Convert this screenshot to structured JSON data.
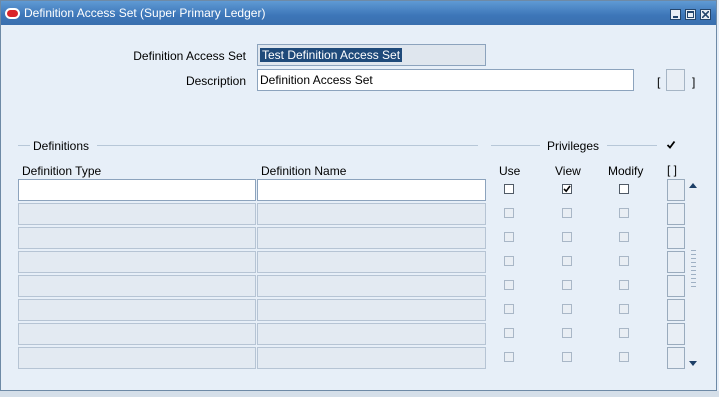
{
  "window": {
    "title": "Definition Access Set (Super Primary Ledger)"
  },
  "form": {
    "access_set_label": "Definition Access Set",
    "access_set_value": "Test Definition Access Set",
    "description_label": "Description",
    "description_value": "Definition Access Set",
    "dff_open": "[",
    "dff_close": "]"
  },
  "definitions": {
    "section_title": "Definitions",
    "privileges_title": "Privileges",
    "col_type": "Definition Type",
    "col_name": "Definition Name",
    "col_use": "Use",
    "col_view": "View",
    "col_modify": "Modify",
    "col_dff": "[ ]",
    "header_checkbox_checked": true,
    "rows": [
      {
        "type": "",
        "name": "",
        "use": false,
        "view": true,
        "modify": false,
        "enabled": true
      },
      {
        "type": "",
        "name": "",
        "use": false,
        "view": false,
        "modify": false,
        "enabled": false
      },
      {
        "type": "",
        "name": "",
        "use": false,
        "view": false,
        "modify": false,
        "enabled": false
      },
      {
        "type": "",
        "name": "",
        "use": false,
        "view": false,
        "modify": false,
        "enabled": false
      },
      {
        "type": "",
        "name": "",
        "use": false,
        "view": false,
        "modify": false,
        "enabled": false
      },
      {
        "type": "",
        "name": "",
        "use": false,
        "view": false,
        "modify": false,
        "enabled": false
      },
      {
        "type": "",
        "name": "",
        "use": false,
        "view": false,
        "modify": false,
        "enabled": false
      },
      {
        "type": "",
        "name": "",
        "use": false,
        "view": false,
        "modify": false,
        "enabled": false
      }
    ]
  },
  "icons": {
    "app": "oracle-icon",
    "minimize": "minimize-icon",
    "maximize": "maximize-icon",
    "close": "close-icon",
    "check": "✓"
  }
}
